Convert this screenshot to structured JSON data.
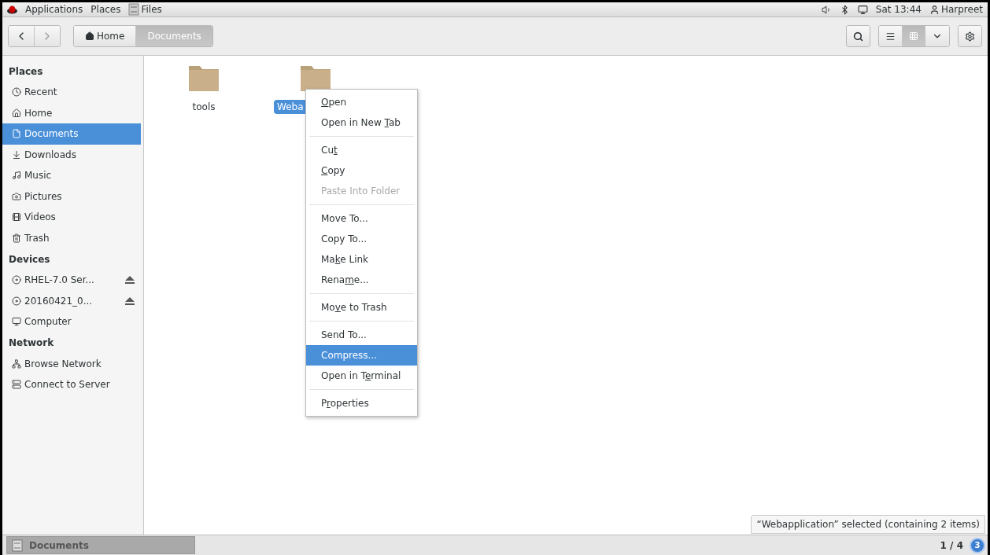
{
  "top_bar": {
    "menus": [
      "Applications",
      "Places"
    ],
    "app": "Files",
    "clock": "Sat 13:44",
    "user": "Harpreet"
  },
  "toolbar": {
    "breadcrumbs": [
      {
        "label": "Home",
        "selected": false
      },
      {
        "label": "Documents",
        "selected": true
      }
    ],
    "view_buttons": [
      {
        "selected": false
      },
      {
        "selected": true
      }
    ]
  },
  "sidebar": {
    "sections": [
      {
        "title": "Places",
        "items": [
          {
            "label": "Recent",
            "selected": false
          },
          {
            "label": "Home",
            "selected": false
          },
          {
            "label": "Documents",
            "selected": true
          },
          {
            "label": "Downloads",
            "selected": false
          },
          {
            "label": "Music",
            "selected": false
          },
          {
            "label": "Pictures",
            "selected": false
          },
          {
            "label": "Videos",
            "selected": false
          },
          {
            "label": "Trash",
            "selected": false
          }
        ]
      },
      {
        "title": "Devices",
        "items": [
          {
            "label": "RHEL-7.0 Ser...",
            "selected": false,
            "ejectable": true
          },
          {
            "label": "20160421_0...",
            "selected": false,
            "ejectable": true
          },
          {
            "label": "Computer",
            "selected": false,
            "ejectable": false
          }
        ]
      },
      {
        "title": "Network",
        "items": [
          {
            "label": "Browse Network",
            "selected": false
          },
          {
            "label": "Connect to Server",
            "selected": false
          }
        ]
      }
    ]
  },
  "files": [
    {
      "name": "tools",
      "selected": false
    },
    {
      "name": "Weba",
      "selected": true
    }
  ],
  "context_menu": {
    "groups": [
      [
        {
          "key": "O",
          "post": "pen",
          "disabled": false,
          "selected": false
        },
        {
          "pre": "Open in New ",
          "key": "T",
          "post": "ab",
          "disabled": false,
          "selected": false
        }
      ],
      [
        {
          "pre": "Cu",
          "key": "t",
          "disabled": false,
          "selected": false
        },
        {
          "key": "C",
          "post": "opy",
          "disabled": false,
          "selected": false
        },
        {
          "pre": "Paste Into Folder",
          "disabled": true,
          "selected": false
        }
      ],
      [
        {
          "pre": "Move To...",
          "disabled": false,
          "selected": false
        },
        {
          "pre": "Copy To...",
          "disabled": false,
          "selected": false
        },
        {
          "pre": "Ma",
          "key": "k",
          "post": "e Link",
          "disabled": false,
          "selected": false
        },
        {
          "pre": "Rena",
          "key": "m",
          "post": "e...",
          "disabled": false,
          "selected": false
        }
      ],
      [
        {
          "pre": "Mo",
          "key": "v",
          "post": "e to Trash",
          "disabled": false,
          "selected": false
        }
      ],
      [
        {
          "pre": "Send To...",
          "disabled": false,
          "selected": false
        },
        {
          "pre": "Compress...",
          "disabled": false,
          "selected": true
        },
        {
          "pre": "Open in T",
          "key": "e",
          "post": "rminal",
          "disabled": false,
          "selected": false
        }
      ],
      [
        {
          "pre": "P",
          "key": "r",
          "post": "operties",
          "disabled": false,
          "selected": false
        }
      ]
    ]
  },
  "status": "“Webapplication” selected (containing 2 items)",
  "taskbar": {
    "window": "Documents",
    "workspace": "1 / 4",
    "notifications": "3"
  }
}
